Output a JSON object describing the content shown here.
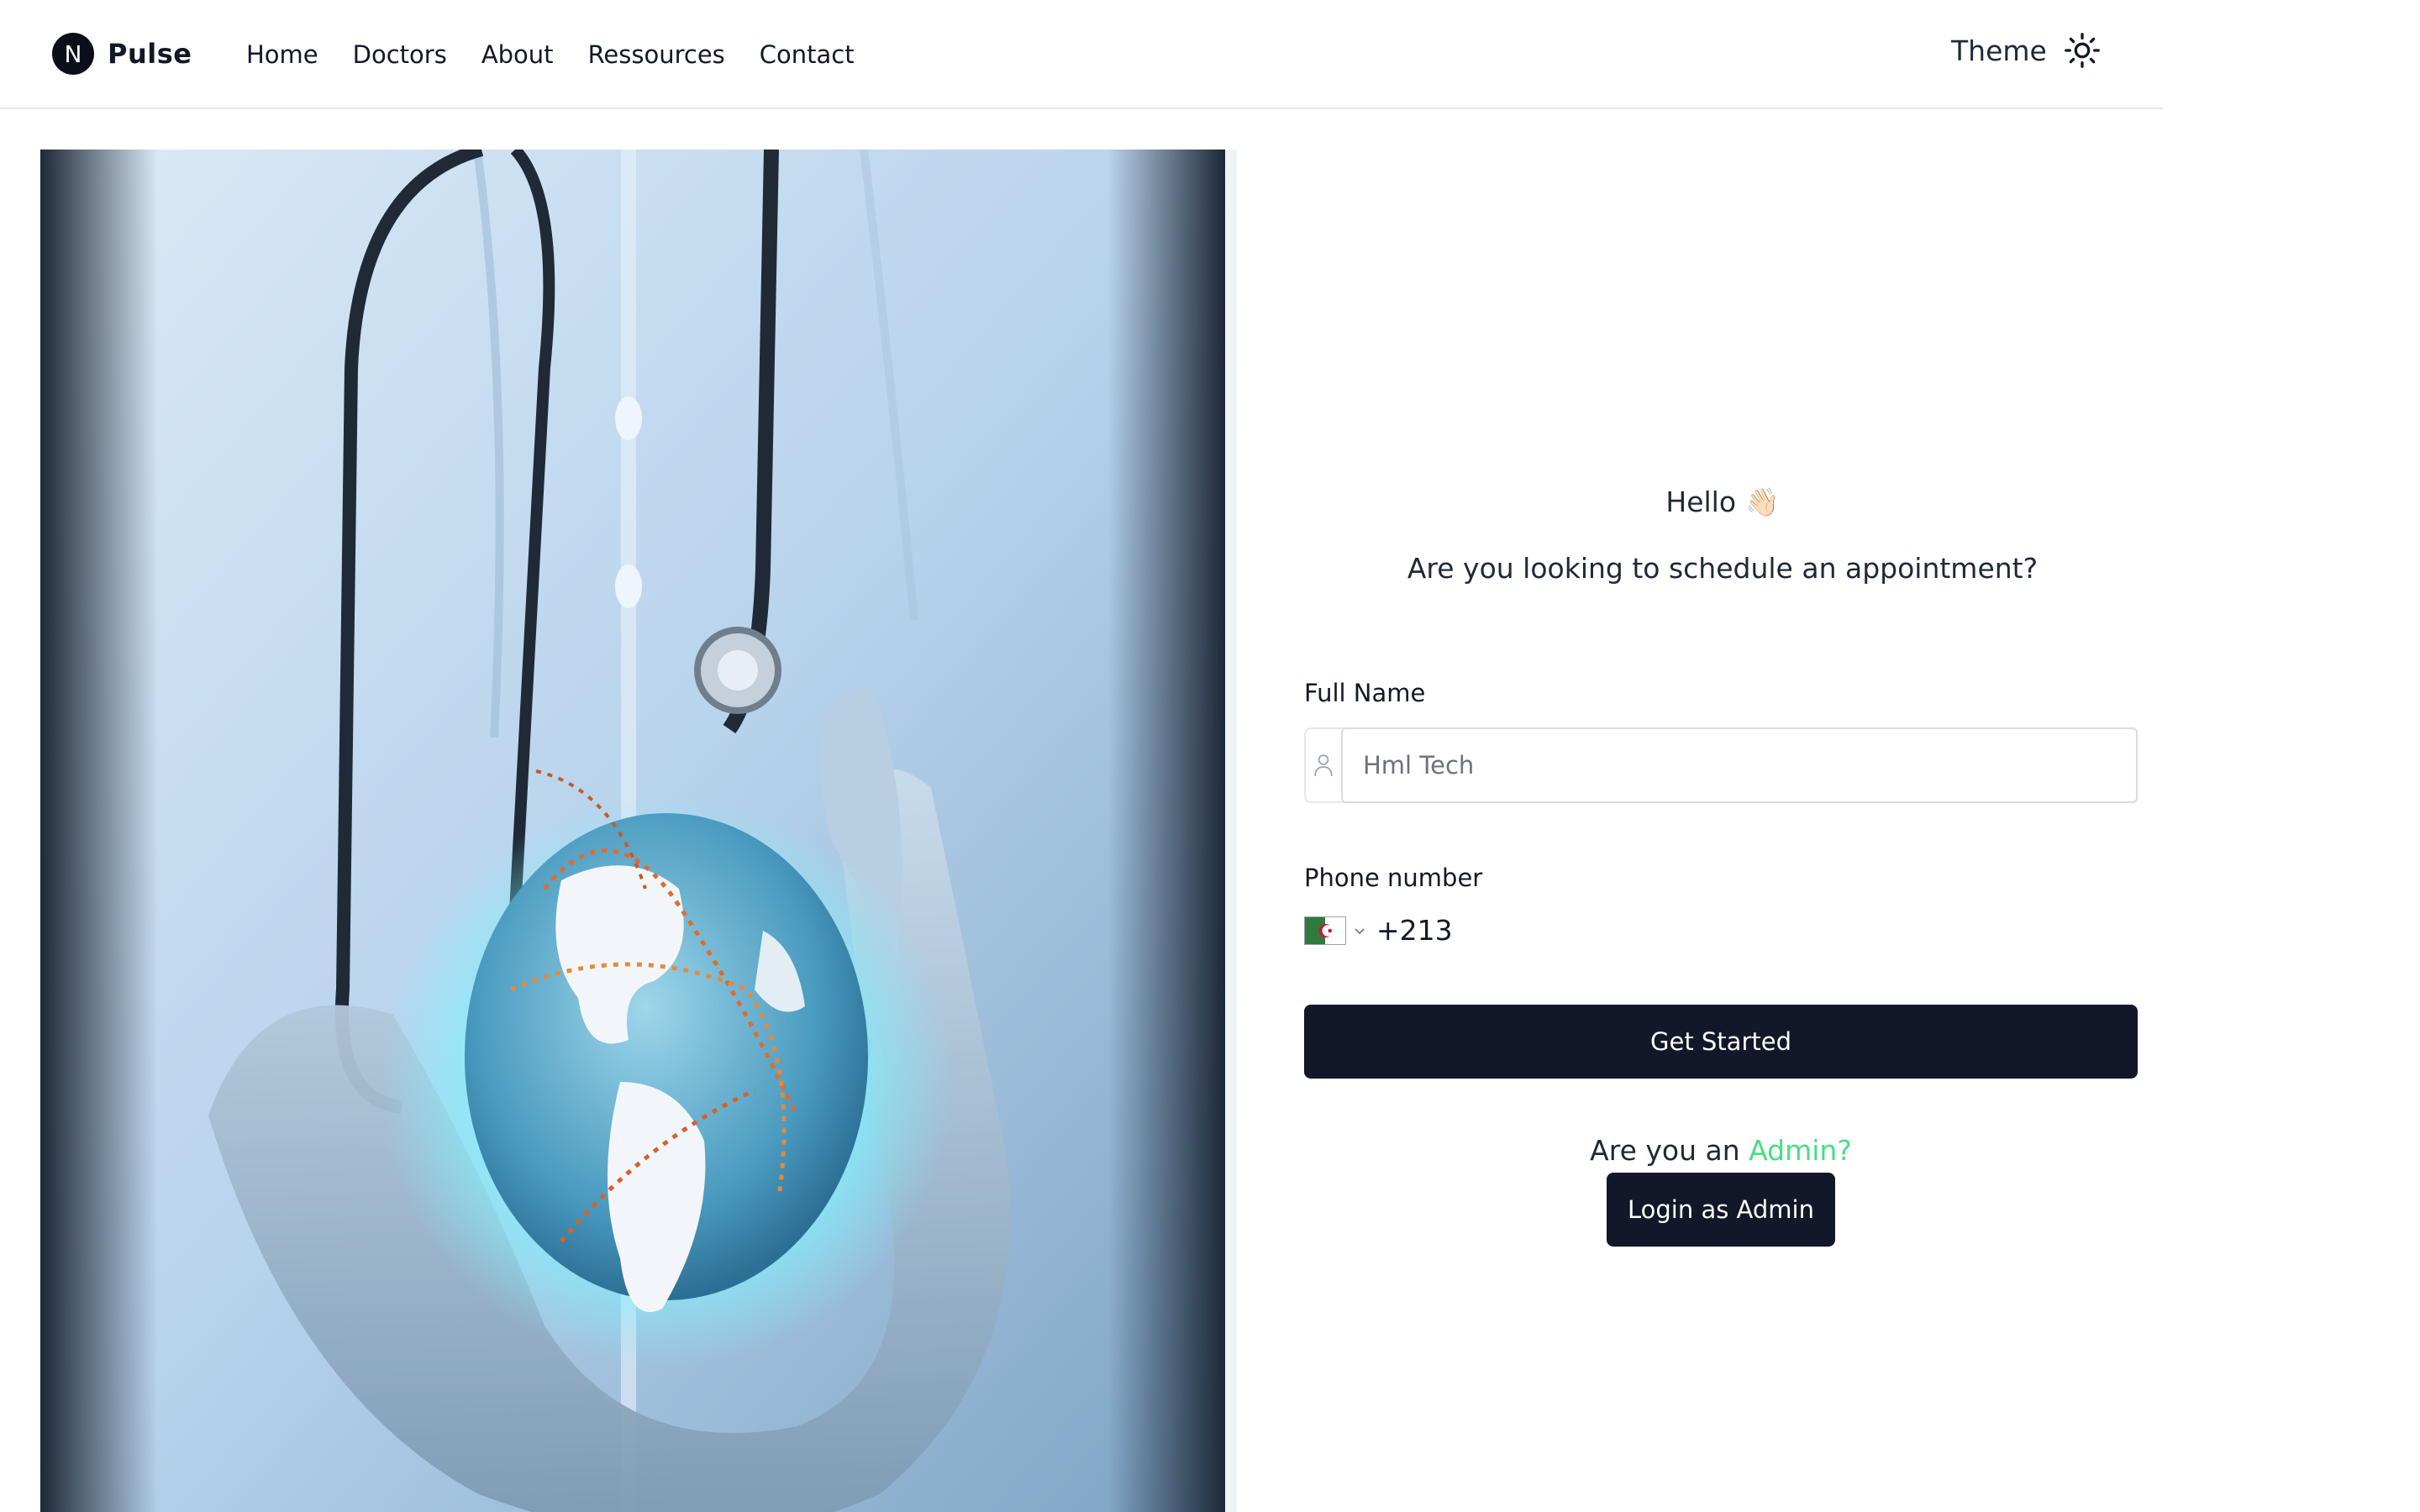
{
  "header": {
    "logo_letter": "N",
    "brand": "Pulse",
    "nav": [
      "Home",
      "Doctors",
      "About",
      "Ressources",
      "Contact"
    ],
    "theme_label": "Theme",
    "theme_icon": "sun-icon"
  },
  "hero": {
    "icons": [
      "stethoscope",
      "gloved-hands",
      "glowing-globe"
    ]
  },
  "form": {
    "greeting": "Hello 👋🏻",
    "question": "Are you looking to schedule an appointment?",
    "full_name_label": "Full Name",
    "full_name_placeholder": "Hml Tech",
    "full_name_icon": "user-icon",
    "phone_label": "Phone number",
    "phone_value": "+213",
    "phone_country_icon": "algeria-flag-icon",
    "submit_label": "Get Started",
    "admin_prompt": "Are you an",
    "admin_link": "Admin?",
    "admin_button": "Login as Admin"
  },
  "colors": {
    "primary": "#121829",
    "accent": "#4ade80",
    "border": "#e5e7eb"
  }
}
